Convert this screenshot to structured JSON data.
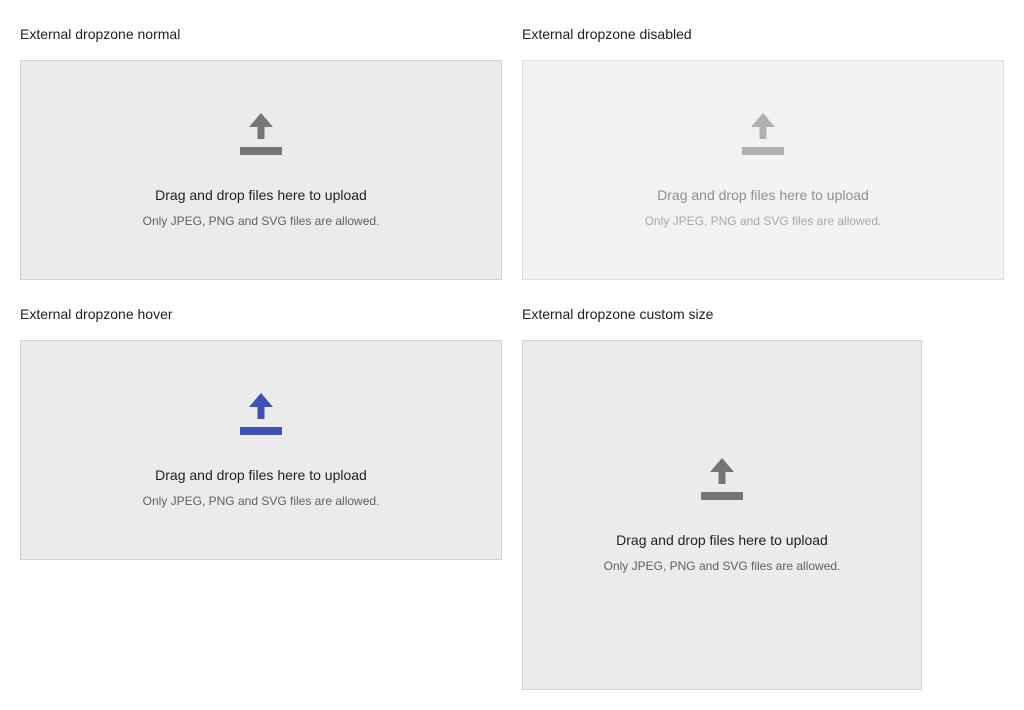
{
  "sections": [
    {
      "title": "External dropzone normal",
      "state": "normal",
      "icon": "upload-icon",
      "icon_color": "#757575",
      "main_text": "Drag and drop files here to upload",
      "sub_text": "Only JPEG, PNG and SVG files are allowed."
    },
    {
      "title": "External dropzone disabled",
      "state": "disabled",
      "icon": "upload-icon",
      "icon_color": "#b0b0b0",
      "main_text": "Drag and drop files here to upload",
      "sub_text": "Only JPEG, PNG and SVG files are allowed."
    },
    {
      "title": "External dropzone hover",
      "state": "hover",
      "icon": "upload-icon",
      "icon_color": "#3f51b5",
      "main_text": "Drag and drop files here to upload",
      "sub_text": "Only JPEG, PNG and SVG files are allowed."
    },
    {
      "title": "External dropzone custom size",
      "state": "normal",
      "icon": "upload-icon",
      "icon_color": "#757575",
      "main_text": "Drag and drop files here to upload",
      "sub_text": "Only JPEG, PNG and SVG files are allowed."
    }
  ]
}
